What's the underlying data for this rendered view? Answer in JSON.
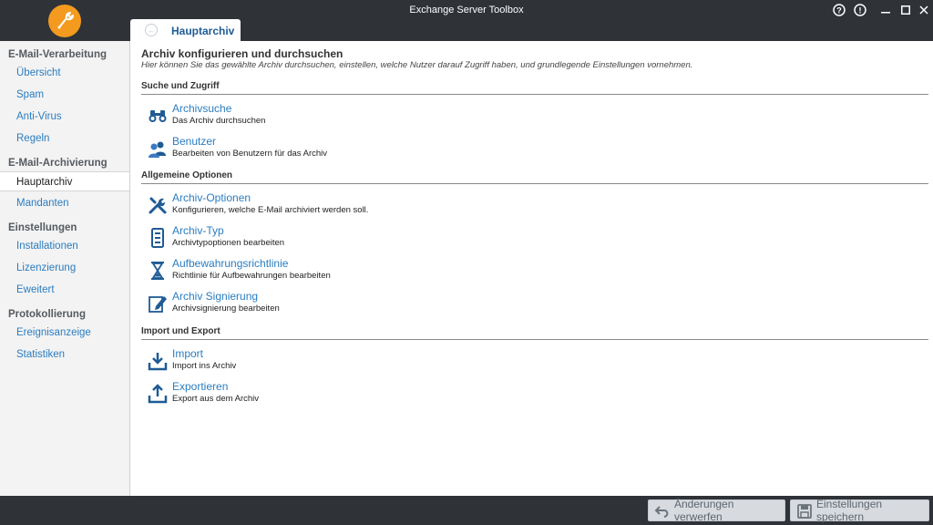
{
  "window": {
    "title": "Exchange Server Toolbox"
  },
  "titlebar": {
    "help_icon": "?",
    "info_icon": "!",
    "minimize_icon": "–",
    "maximize_icon": "□",
    "close_icon": "✕"
  },
  "tab": {
    "label": "Hauptarchiv"
  },
  "sidebar": {
    "sections": [
      {
        "heading": "E-Mail-Verarbeitung",
        "items": [
          "Übersicht",
          "Spam",
          "Anti-Virus",
          "Regeln"
        ]
      },
      {
        "heading": "E-Mail-Archivierung",
        "items": [
          "Hauptarchiv",
          "Mandanten"
        ]
      },
      {
        "heading": "Einstellungen",
        "items": [
          "Installationen",
          "Lizenzierung",
          "Eweitert"
        ]
      },
      {
        "heading": "Protokollierung",
        "items": [
          "Ereignisanzeige",
          "Statistiken"
        ]
      }
    ],
    "active_item": "Hauptarchiv"
  },
  "main": {
    "title": "Archiv konfigurieren und durchsuchen",
    "subtitle": "Hier können Sie das gewählte Archiv durchsuchen, einstellen, welche Nutzer darauf Zugriff haben, und grundlegende Einstellungen vornehmen.",
    "sections": [
      {
        "heading": "Suche und Zugriff",
        "options": [
          {
            "title": "Archivsuche",
            "desc": "Das Archiv durchsuchen",
            "icon": "binoculars-icon"
          },
          {
            "title": "Benutzer",
            "desc": "Bearbeiten von Benutzern für das Archiv",
            "icon": "users-icon"
          }
        ]
      },
      {
        "heading": "Allgemeine Optionen",
        "options": [
          {
            "title": "Archiv-Optionen",
            "desc": "Konfigurieren, welche E-Mail archiviert werden soll.",
            "icon": "tools-icon"
          },
          {
            "title": "Archiv-Typ",
            "desc": "Archivtypoptionen bearbeiten",
            "icon": "archive-type-icon"
          },
          {
            "title": "Aufbewahrungsrichtlinie",
            "desc": "Richtlinie für Aufbewahrungen bearbeiten",
            "icon": "hourglass-icon"
          },
          {
            "title": "Archiv Signierung",
            "desc": "Archivsignierung bearbeiten",
            "icon": "signature-icon"
          }
        ]
      },
      {
        "heading": "Import und Export",
        "options": [
          {
            "title": "Import",
            "desc": "Import ins Archiv",
            "icon": "import-icon"
          },
          {
            "title": "Exportieren",
            "desc": "Export aus dem Archiv",
            "icon": "export-icon"
          }
        ]
      }
    ]
  },
  "footer": {
    "discard_label": "Änderungen verwerfen",
    "save_label": "Einstellungen speichern"
  },
  "colors": {
    "accent": "#2a7dc0",
    "logo": "#f39a1f",
    "chrome": "#2f3338"
  }
}
